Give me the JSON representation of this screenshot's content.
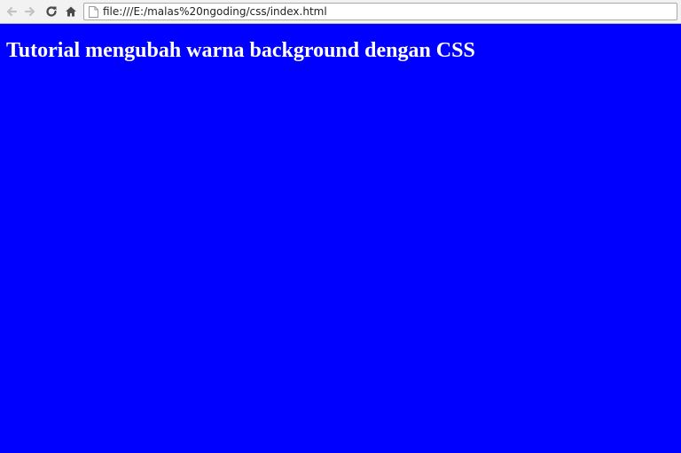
{
  "browser": {
    "url": "file:///E:/malas%20ngoding/css/index.html",
    "icons": {
      "back": "back-arrow-icon",
      "forward": "forward-arrow-icon",
      "reload": "reload-icon",
      "home": "home-icon",
      "page": "page-icon"
    }
  },
  "page": {
    "heading": "Tutorial mengubah warna background dengan CSS",
    "background_color": "#0000ff",
    "heading_color": "#ffffff"
  }
}
